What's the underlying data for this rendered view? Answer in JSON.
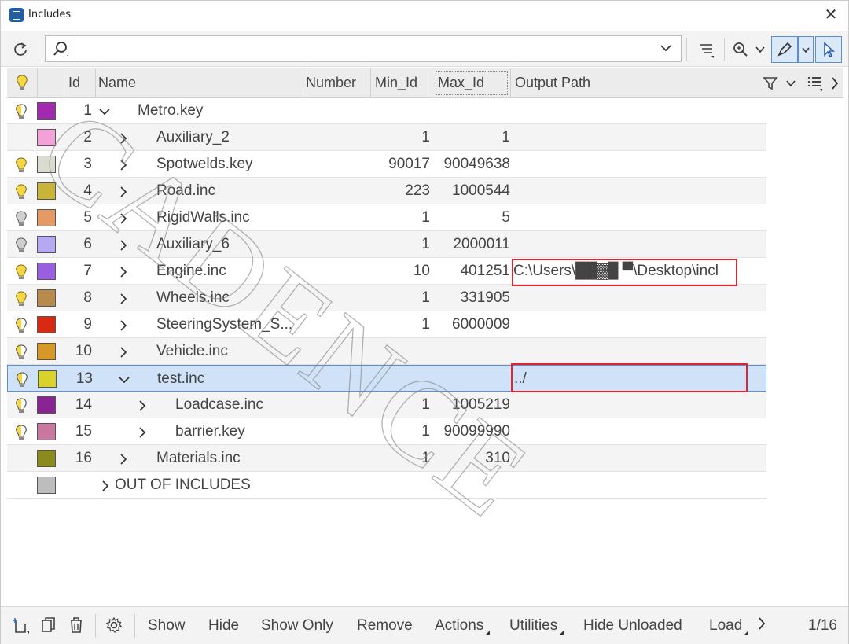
{
  "window": {
    "title": "Includes"
  },
  "toolbar": {
    "search_placeholder": "",
    "search_value": ""
  },
  "columns": {
    "id": "Id",
    "name": "Name",
    "number": "Number",
    "min_id": "Min_Id",
    "max_id": "Max_Id",
    "output_path": "Output Path"
  },
  "rows": [
    {
      "id": "1",
      "name": "Metro.key",
      "min": "",
      "max": "",
      "path": "",
      "color": "#a32ab0",
      "bulb": "yellow-half",
      "expanded": true,
      "level": 0
    },
    {
      "id": "2",
      "name": "Auxiliary_2",
      "min": "1",
      "max": "1",
      "path": "",
      "color": "#f3a2d8",
      "bulb": "none",
      "expanded": false,
      "level": 1
    },
    {
      "id": "3",
      "name": "Spotwelds.key",
      "min": "90017",
      "max": "90049638",
      "path": "",
      "color": "#d9dccf",
      "bulb": "yellow",
      "expanded": false,
      "level": 1
    },
    {
      "id": "4",
      "name": "Road.inc",
      "min": "223",
      "max": "1000544",
      "path": "",
      "color": "#c9b43a",
      "bulb": "yellow",
      "expanded": false,
      "level": 1
    },
    {
      "id": "5",
      "name": "RigidWalls.inc",
      "min": "1",
      "max": "5",
      "path": "",
      "color": "#e59a66",
      "bulb": "grey",
      "expanded": false,
      "level": 1
    },
    {
      "id": "6",
      "name": "Auxiliary_6",
      "min": "1",
      "max": "2000011",
      "path": "",
      "color": "#b6a8f2",
      "bulb": "grey",
      "expanded": false,
      "level": 1
    },
    {
      "id": "7",
      "name": "Engine.inc",
      "min": "10",
      "max": "401251",
      "path": "C:\\Users\\██▓█ ▀\\Desktop\\incl",
      "color": "#9a5ee0",
      "bulb": "yellow",
      "expanded": false,
      "level": 1
    },
    {
      "id": "8",
      "name": "Wheels.inc",
      "min": "1",
      "max": "331905",
      "path": "",
      "color": "#b88a4c",
      "bulb": "yellow",
      "expanded": false,
      "level": 1
    },
    {
      "id": "9",
      "name": "SteeringSystem_S...",
      "min": "1",
      "max": "6000009",
      "path": "",
      "color": "#d82a12",
      "bulb": "yellow-half",
      "expanded": false,
      "level": 1
    },
    {
      "id": "10",
      "name": "Vehicle.inc",
      "min": "",
      "max": "",
      "path": "",
      "color": "#d69828",
      "bulb": "yellow-half",
      "expanded": false,
      "level": 1
    },
    {
      "id": "13",
      "name": "test.inc",
      "min": "",
      "max": "",
      "path": "../",
      "color": "#d8d22a",
      "bulb": "yellow-half",
      "expanded": true,
      "level": 1,
      "selected": true
    },
    {
      "id": "14",
      "name": "Loadcase.inc",
      "min": "1",
      "max": "1005219",
      "path": "",
      "color": "#8a2394",
      "bulb": "yellow-half",
      "expanded": false,
      "level": 2
    },
    {
      "id": "15",
      "name": "barrier.key",
      "min": "1",
      "max": "90099990",
      "path": "",
      "color": "#c9779f",
      "bulb": "yellow-half",
      "expanded": false,
      "level": 2
    },
    {
      "id": "16",
      "name": "Materials.inc",
      "min": "1",
      "max": "310",
      "path": "",
      "color": "#8a8a1e",
      "bulb": "none",
      "expanded": false,
      "level": 1
    },
    {
      "id": "",
      "name": "OUT OF INCLUDES",
      "min": "",
      "max": "",
      "path": "",
      "color": "#bdbdbd",
      "bulb": "none",
      "expanded": false,
      "level": -1
    }
  ],
  "bottom": {
    "show": "Show",
    "hide": "Hide",
    "show_only": "Show Only",
    "remove": "Remove",
    "actions": "Actions",
    "utilities": "Utilities",
    "hide_unloaded": "Hide Unloaded",
    "load": "Load",
    "count": "1/16"
  },
  "watermark": "CADENCE"
}
